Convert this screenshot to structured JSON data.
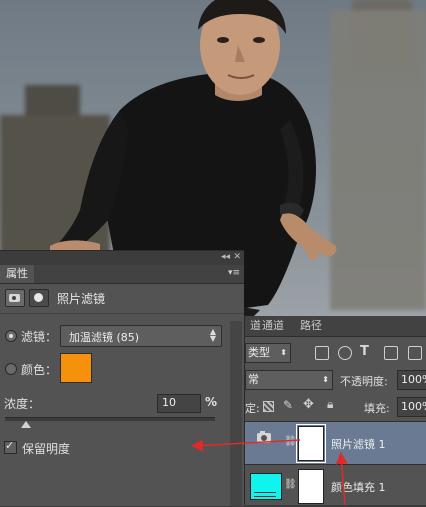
{
  "properties": {
    "tab_label": "属性",
    "title": "照片滤镜",
    "filter_label": "滤镜：",
    "filter_value": "加温滤镜 (85)",
    "color_label": "颜色：",
    "color_value": "#f5910d",
    "density_label": "浓度：",
    "density_value": "10",
    "density_unit": "%",
    "density_level_percent": 10,
    "preserve_label": "保留明度",
    "preserve_checked": true
  },
  "layers": {
    "tabs": [
      "道",
      "通道",
      "路径"
    ],
    "kind_label": "类型",
    "blend_label": "常",
    "opacity_label": "不透明度:",
    "opacity_value": "100%",
    "lock_label": "定:",
    "fill_label": "填充:",
    "fill_value": "100%",
    "items": [
      {
        "name": "照片滤镜 1",
        "selected": true
      },
      {
        "name": "颜色填充 1",
        "selected": false,
        "swatch": "#10f4ef"
      }
    ]
  },
  "colors": {
    "annotation_arrow": "#e02a2a",
    "panel_bg": "#535353",
    "selected_layer": "#6a7a93"
  }
}
